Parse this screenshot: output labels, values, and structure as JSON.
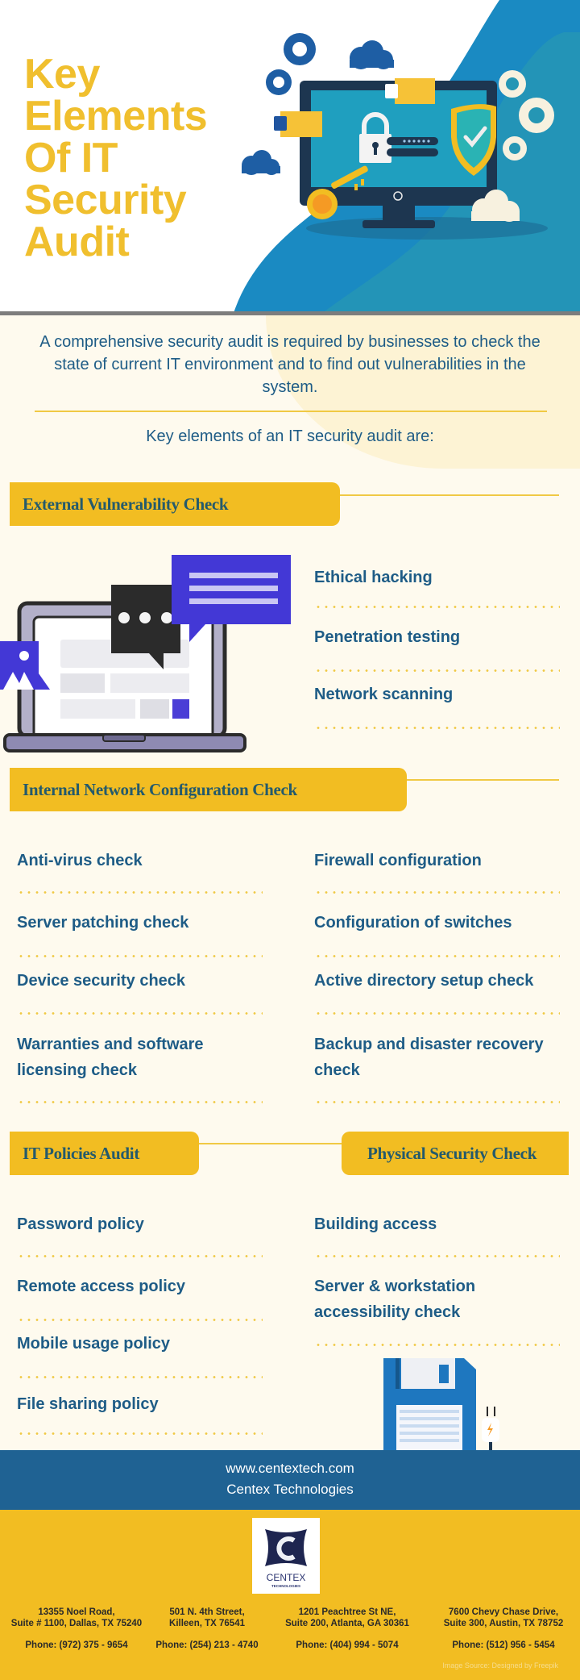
{
  "hero": {
    "title_lines": [
      "Key",
      "Elements",
      "Of IT",
      "Security",
      "Audit"
    ],
    "illustration": "computer-security-illustration"
  },
  "intro": {
    "text": "A comprehensive security audit is required by businesses to check the state of current IT environment and to find out vulnerabilities in the system.",
    "subheading": "Key elements of an IT security audit are:"
  },
  "sections": {
    "external": {
      "title": "External Vulnerability Check",
      "items": [
        "Ethical hacking",
        "Penetration testing",
        "Network scanning"
      ]
    },
    "internal": {
      "title": "Internal Network Configuration Check",
      "left_items": [
        "Anti-virus check",
        "Server patching check",
        "Device security check",
        "Warranties and software licensing check"
      ],
      "right_items": [
        "Firewall configuration",
        "Configuration of switches",
        "Active directory setup check",
        "Backup and disaster recovery check"
      ]
    },
    "policies": {
      "title": "IT Policies Audit",
      "items": [
        "Password policy",
        "Remote access policy",
        "Mobile usage policy",
        "File sharing policy"
      ]
    },
    "physical": {
      "title": "Physical Security Check",
      "items": [
        "Building access",
        "Server & workstation accessibility check"
      ]
    }
  },
  "footer": {
    "website": "www.centextech.com",
    "company": "Centex Technologies",
    "logo_text": "CENTEX",
    "logo_subtext": "TECHNOLOGIES",
    "offices": [
      {
        "line1": "13355 Noel Road,",
        "line2": "Suite # 1100, Dallas, TX 75240",
        "phone": "Phone: (972) 375 - 9654"
      },
      {
        "line1": "501 N. 4th Street,",
        "line2": "Killeen, TX 76541",
        "phone": "Phone: (254) 213 - 4740"
      },
      {
        "line1": "1201 Peachtree St NE,",
        "line2": "Suite 200, Atlanta, GA 30361",
        "phone": "Phone: (404) 994 - 5074"
      },
      {
        "line1": "7600 Chevy Chase Drive,",
        "line2": "Suite 300, Austin, TX 78752",
        "phone": "Phone: (512) 956 - 5454"
      }
    ],
    "credit": "Image Source: Designed by Freepik"
  },
  "colors": {
    "accent_yellow": "#f2bd22",
    "text_blue": "#1e5c86",
    "tag_text": "#245a6c",
    "footer_blue": "#1f6293",
    "background": "#fefaee"
  }
}
